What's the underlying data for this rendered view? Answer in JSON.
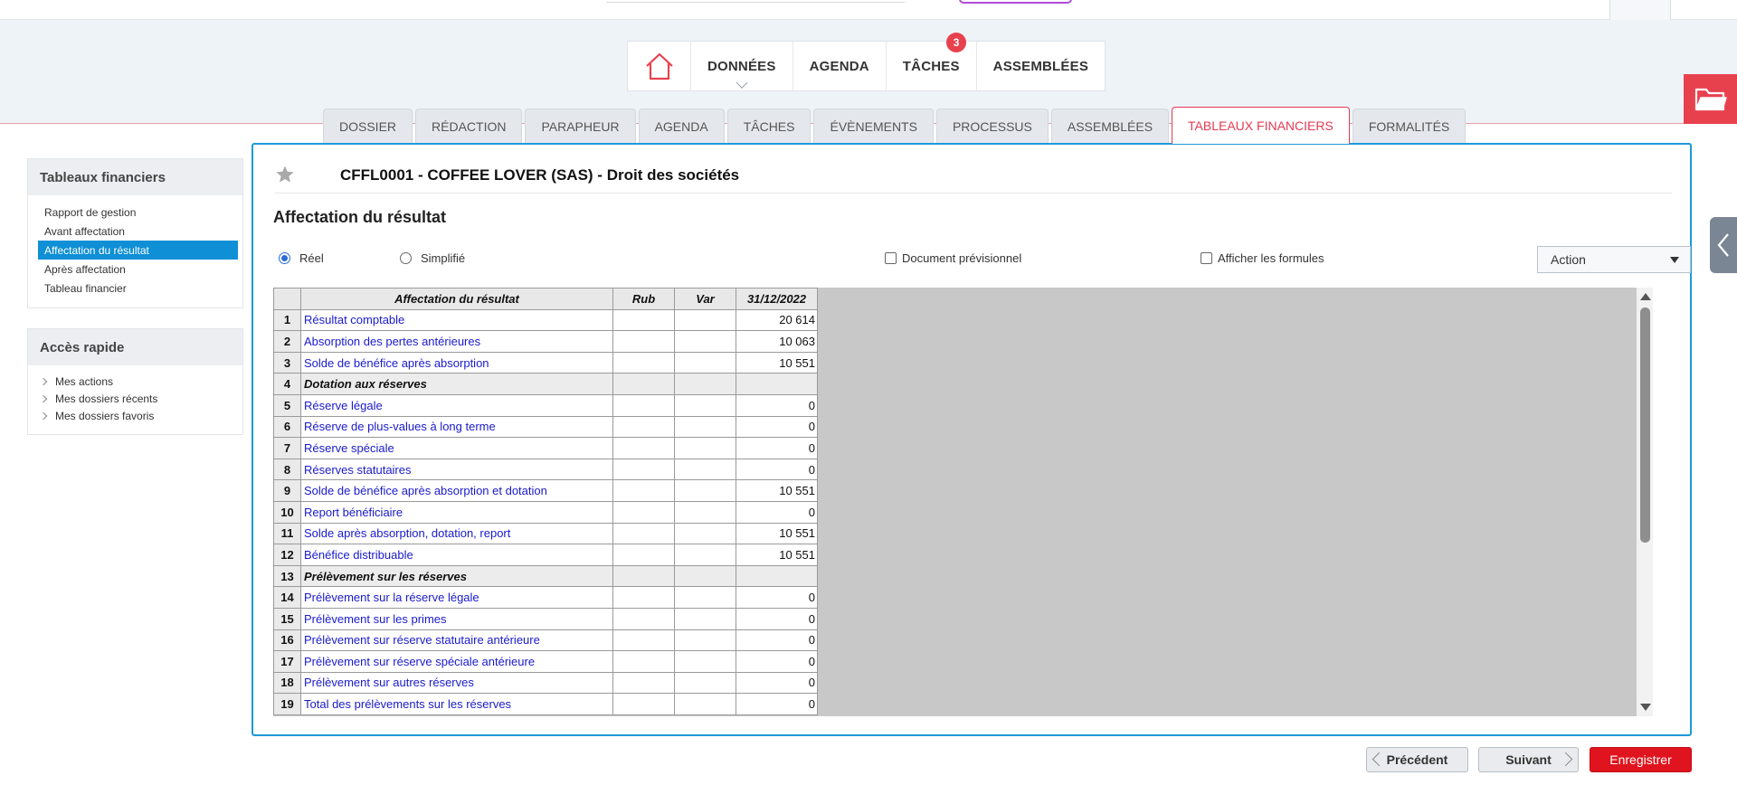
{
  "main_nav": {
    "items": [
      {
        "label": "DONNÉES",
        "active": true
      },
      {
        "label": "AGENDA"
      },
      {
        "label": "TÂCHES",
        "badge": "3"
      },
      {
        "label": "ASSEMBLÉES"
      }
    ]
  },
  "tabs": [
    "DOSSIER",
    "RÉDACTION",
    "PARAPHEUR",
    "AGENDA",
    "TÂCHES",
    "ÉVÈNEMENTS",
    "PROCESSUS",
    "ASSEMBLÉES",
    "TABLEAUX FINANCIERS",
    "FORMALITÉS"
  ],
  "active_tab": "TABLEAUX FINANCIERS",
  "sidebar": {
    "financial": {
      "title": "Tableaux financiers",
      "items": [
        "Rapport de gestion",
        "Avant affectation",
        "Affectation du résultat",
        "Après affectation",
        "Tableau financier"
      ],
      "active": "Affectation du résultat"
    },
    "quick": {
      "title": "Accès rapide",
      "items": [
        "Mes actions",
        "Mes dossiers récents",
        "Mes dossiers favoris"
      ]
    }
  },
  "content": {
    "title": "CFFL0001 - COFFEE LOVER (SAS) - Droit des sociétés",
    "subtitle": "Affectation du résultat",
    "options": {
      "reel": "Réel",
      "simplifie": "Simplifié",
      "previsionnel": "Document prévisionnel",
      "formules": "Afficher les formules"
    },
    "action_label": "Action"
  },
  "table": {
    "headers": [
      "Affectation du résultat",
      "Rub",
      "Var",
      "31/12/2022"
    ],
    "rows": [
      {
        "n": "1",
        "label": "Résultat comptable",
        "value": "20 614"
      },
      {
        "n": "2",
        "label": "Absorption des pertes antérieures",
        "value": "10 063"
      },
      {
        "n": "3",
        "label": "Solde de bénéfice après absorption",
        "value": "10 551"
      },
      {
        "n": "4",
        "label": "Dotation aux réserves",
        "value": "",
        "section": true
      },
      {
        "n": "5",
        "label": "Réserve légale",
        "value": "0"
      },
      {
        "n": "6",
        "label": "Réserve de plus-values à long terme",
        "value": "0"
      },
      {
        "n": "7",
        "label": "Réserve spéciale",
        "value": "0"
      },
      {
        "n": "8",
        "label": "Réserves statutaires",
        "value": "0"
      },
      {
        "n": "9",
        "label": "Solde de bénéfice après absorption et dotation",
        "value": "10 551"
      },
      {
        "n": "10",
        "label": "Report bénéficiaire",
        "value": "0"
      },
      {
        "n": "11",
        "label": "Solde après absorption, dotation, report",
        "value": "10 551"
      },
      {
        "n": "12",
        "label": "Bénéfice distribuable",
        "value": "10 551"
      },
      {
        "n": "13",
        "label": "Prélèvement sur les réserves",
        "value": "",
        "section": true
      },
      {
        "n": "14",
        "label": "Prélèvement sur la réserve légale",
        "value": "0"
      },
      {
        "n": "15",
        "label": "Prélèvement sur les primes",
        "value": "0"
      },
      {
        "n": "16",
        "label": "Prélèvement sur réserve statutaire antérieure",
        "value": "0"
      },
      {
        "n": "17",
        "label": "Prélèvement sur réserve spéciale antérieure",
        "value": "0"
      },
      {
        "n": "18",
        "label": "Prélèvement sur autres réserves",
        "value": "0"
      },
      {
        "n": "19",
        "label": "Total des prélèvements sur les réserves",
        "value": "0"
      }
    ]
  },
  "footer": {
    "prev": "Précédent",
    "next": "Suivant",
    "save": "Enregistrer"
  },
  "colors": {
    "accent_red": "#e23b54",
    "accent_blue": "#1c9ad9",
    "link_blue": "#1a1acc"
  }
}
